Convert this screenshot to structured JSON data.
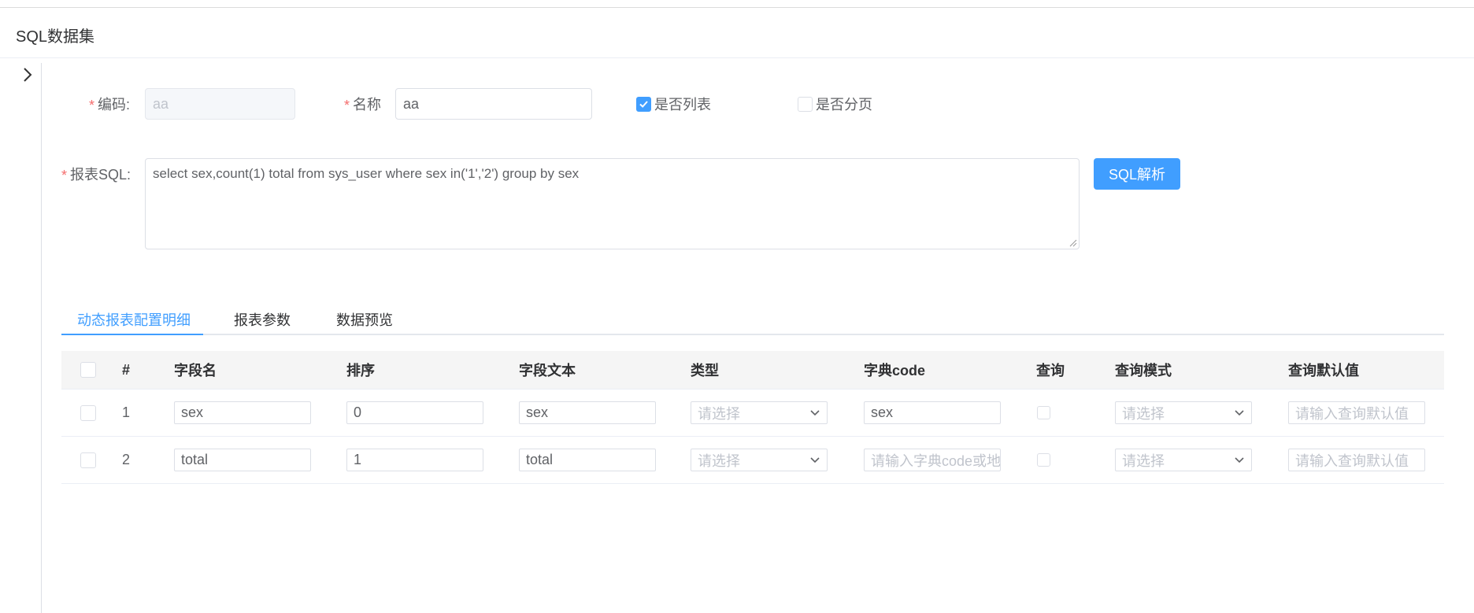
{
  "header": {
    "title": "SQL数据集"
  },
  "form": {
    "code_label": "编码:",
    "code_value": "aa",
    "name_label": "名称",
    "name_value": "aa",
    "is_list_label": "是否列表",
    "is_list_checked": true,
    "is_paged_label": "是否分页",
    "is_paged_checked": false,
    "sql_label": "报表SQL:",
    "sql_value": "select sex,count(1) total from sys_user where sex in('1','2') group by sex",
    "parse_button": "SQL解析"
  },
  "tabs": [
    {
      "label": "动态报表配置明细",
      "active": true
    },
    {
      "label": "报表参数",
      "active": false
    },
    {
      "label": "数据预览",
      "active": false
    }
  ],
  "table": {
    "headers": [
      "#",
      "字段名",
      "排序",
      "字段文本",
      "类型",
      "字典code",
      "查询",
      "查询模式",
      "查询默认值"
    ],
    "rows": [
      {
        "index": "1",
        "field_name": "sex",
        "order": "0",
        "field_text": "sex",
        "type": "请选择",
        "dict_code": "sex",
        "dict_code_placeholder": false,
        "query_mode": "请选择",
        "default_value": "请输入查询默认值"
      },
      {
        "index": "2",
        "field_name": "total",
        "order": "1",
        "field_text": "total",
        "type": "请选择",
        "dict_code": "请输入字典code或地",
        "dict_code_placeholder": true,
        "query_mode": "请选择",
        "default_value": "请输入查询默认值"
      }
    ]
  },
  "colors": {
    "primary": "#409eff",
    "required": "#f56c6c",
    "header_bg": "#f5f5f5"
  }
}
